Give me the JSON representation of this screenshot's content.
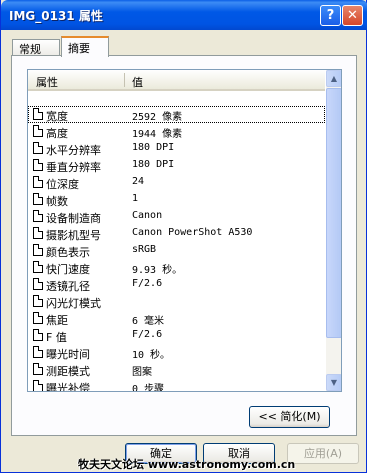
{
  "window": {
    "title": "IMG_0131 属性",
    "help_label": "?",
    "close_label": "✕"
  },
  "tabs": [
    {
      "label": "常规"
    },
    {
      "label": "摘要"
    }
  ],
  "list": {
    "headers": {
      "property": "属性",
      "value": "值"
    },
    "rows": [
      {
        "name": "宽度",
        "value": "2592 像素"
      },
      {
        "name": "高度",
        "value": "1944 像素"
      },
      {
        "name": "水平分辨率",
        "value": "180 DPI"
      },
      {
        "name": "垂直分辨率",
        "value": "180 DPI"
      },
      {
        "name": "位深度",
        "value": "24"
      },
      {
        "name": "帧数",
        "value": "1"
      },
      {
        "name": "设备制造商",
        "value": "Canon"
      },
      {
        "name": "摄影机型号",
        "value": "Canon PowerShot A530"
      },
      {
        "name": "颜色表示",
        "value": "sRGB"
      },
      {
        "name": "快门速度",
        "value": "9.93 秒。"
      },
      {
        "name": "透镜孔径",
        "value": "F/2.6"
      },
      {
        "name": "闪光灯模式",
        "value": ""
      },
      {
        "name": "焦距",
        "value": "6 毫米"
      },
      {
        "name": "F 值",
        "value": "F/2.6"
      },
      {
        "name": "曝光时间",
        "value": "10 秒。"
      },
      {
        "name": "测距模式",
        "value": "图案"
      },
      {
        "name": "曝光补偿",
        "value": "0 步骤"
      }
    ]
  },
  "buttons": {
    "simplify": "<< 简化(M)",
    "ok": "确定",
    "cancel": "取消",
    "apply": "应用(A)"
  },
  "watermark": "牧夫天文论坛 www.astronomy.com.cn"
}
